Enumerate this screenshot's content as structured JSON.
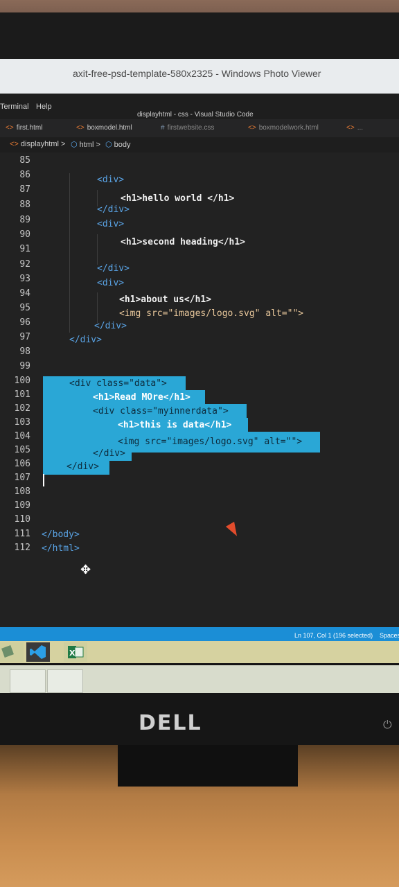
{
  "photo_viewer": {
    "title": "axit-free-psd-template-580x2325 - Windows Photo Viewer"
  },
  "vscode": {
    "menu": [
      "Terminal",
      "Help"
    ],
    "window_title": "displayhtml - css - Visual Studio Code",
    "tabs": [
      {
        "label": "first.html"
      },
      {
        "label": "boxmodel.html"
      },
      {
        "label": "firstwebsite.css"
      },
      {
        "label": "boxmodelwork.html"
      },
      {
        "label": "..."
      }
    ],
    "breadcrumb": [
      "displayhtml",
      "html",
      "body"
    ],
    "lines": [
      {
        "n": "85"
      },
      {
        "n": "86"
      },
      {
        "n": "87"
      },
      {
        "n": "88"
      },
      {
        "n": "89"
      },
      {
        "n": "90"
      },
      {
        "n": "91"
      },
      {
        "n": "92"
      },
      {
        "n": "93"
      },
      {
        "n": "94"
      },
      {
        "n": "95"
      },
      {
        "n": "96"
      },
      {
        "n": "97"
      },
      {
        "n": "98"
      },
      {
        "n": "99"
      },
      {
        "n": "100"
      },
      {
        "n": "101"
      },
      {
        "n": "102"
      },
      {
        "n": "103"
      },
      {
        "n": "104"
      },
      {
        "n": "105"
      },
      {
        "n": "106"
      },
      {
        "n": "107"
      },
      {
        "n": "108"
      },
      {
        "n": "109"
      },
      {
        "n": "110"
      },
      {
        "n": "111"
      },
      {
        "n": "112"
      }
    ],
    "code": {
      "l86": "<div>",
      "l87": "<h1>hello world </h1>",
      "l88": "</div>",
      "l89": "<div>",
      "l90": "<h1>second heading</h1>",
      "l92": "</div>",
      "l93": "<div>",
      "l94": "<h1>about us</h1>",
      "l95": "<img src=\"images/logo.svg\" alt=\"\">",
      "l96": "</div>",
      "l97": "</div>",
      "l100": "<div class=\"data\">",
      "l101": "<h1>Read MOre</h1>",
      "l102": "<div class=\"myinnerdata\">",
      "l103": "<h1>this is data</h1>",
      "l104": "<img src=\"images/logo.svg\" alt=\"\">",
      "l105": "</div>",
      "l106": "</div>",
      "l111": "</body>",
      "l112": "</html>"
    },
    "status": {
      "position": "Ln 107, Col 1 (196 selected)",
      "spaces": "Spaces"
    }
  },
  "monitor": {
    "brand": "DELL"
  },
  "colors": {
    "status_bar": "#1b8ed6",
    "selection": "#2aa7d6",
    "tag": "#5aa4e6",
    "editor_bg": "#222222"
  },
  "icons": [
    "move-icon",
    "vscode-icon",
    "excel-icon",
    "power-icon"
  ]
}
